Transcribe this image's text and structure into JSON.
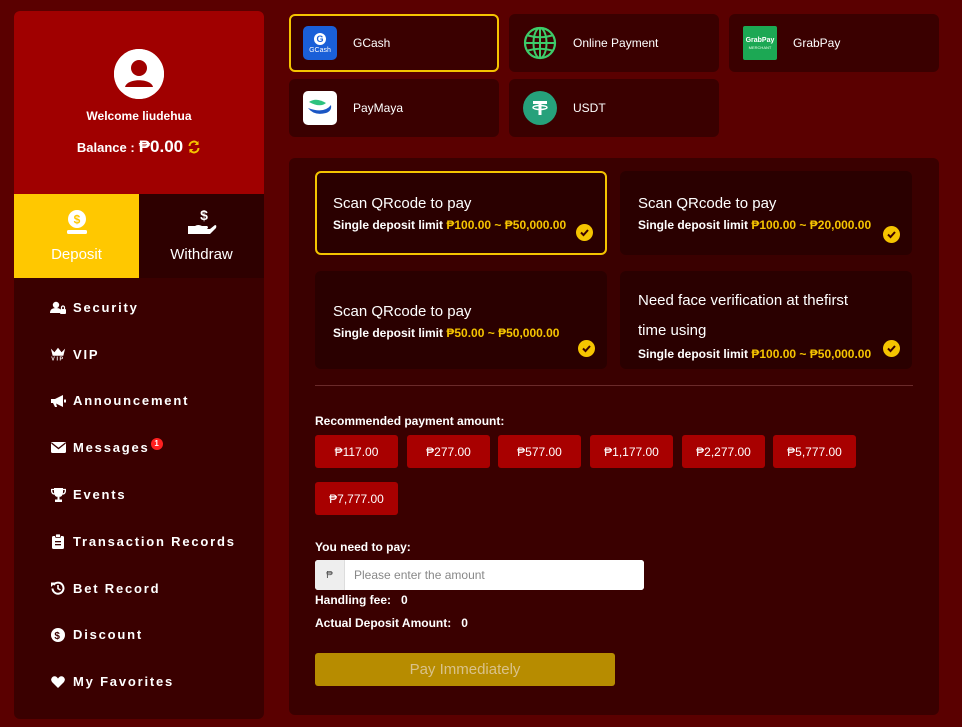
{
  "profile": {
    "welcome": "Welcome liudehua",
    "balance_label": "Balance :",
    "balance_value": "₱0.00"
  },
  "tabs": {
    "deposit": "Deposit",
    "withdraw": "Withdraw"
  },
  "menu": [
    {
      "label": "Security",
      "icon": "user-lock-icon"
    },
    {
      "label": "VIP",
      "icon": "vip-crown-icon"
    },
    {
      "label": "Announcement",
      "icon": "megaphone-icon"
    },
    {
      "label": "Messages",
      "icon": "envelope-icon",
      "badge": "1"
    },
    {
      "label": "Events",
      "icon": "trophy-icon"
    },
    {
      "label": "Transaction Records",
      "icon": "clipboard-icon"
    },
    {
      "label": "Bet Record",
      "icon": "history-icon"
    },
    {
      "label": "Discount",
      "icon": "dollar-circle-icon"
    },
    {
      "label": "My Favorites",
      "icon": "heart-icon"
    }
  ],
  "payment_methods": [
    {
      "label": "GCash",
      "icon": "gcash-logo",
      "logo_text": "GCash",
      "selected": true
    },
    {
      "label": "Online Payment",
      "icon": "globe-icon"
    },
    {
      "label": "GrabPay",
      "icon": "grabpay-logo",
      "logo_text": "GrabPay",
      "logo_sub": "MERCHANT"
    },
    {
      "label": "PayMaya",
      "icon": "paymaya-logo"
    },
    {
      "label": "USDT",
      "icon": "tether-icon"
    }
  ],
  "channels": [
    {
      "title": "Scan QRcode to pay",
      "limit_label": "Single deposit limit",
      "min": "₱100.00",
      "sep": " ~ ",
      "max": "₱50,000.00",
      "selected": true
    },
    {
      "title": "Scan QRcode to pay",
      "limit_label": "Single deposit limit",
      "min": "₱100.00",
      "sep": " ~ ",
      "max": "₱20,000.00"
    },
    {
      "title": "Scan QRcode to pay",
      "limit_label": "Single deposit limit",
      "min": "₱50.00",
      "sep": " ~ ",
      "max": "₱50,000.00"
    },
    {
      "title": "Need face verification at thefirst time using",
      "limit_label": "Single deposit limit",
      "min": "₱100.00",
      "sep": " ~ ",
      "max": "₱50,000.00"
    }
  ],
  "recommended": {
    "label": "Recommended payment amount:",
    "amounts": [
      "₱117.00",
      "₱277.00",
      "₱577.00",
      "₱1,177.00",
      "₱2,277.00",
      "₱5,777.00",
      "₱7,777.00"
    ]
  },
  "payment_form": {
    "need_to_pay_label": "You need to pay:",
    "currency_symbol": "₱",
    "amount_placeholder": "Please enter the amount",
    "handling_fee_label": "Handling fee:",
    "handling_fee_value": "0",
    "actual_deposit_label": "Actual Deposit Amount:",
    "actual_deposit_value": "0",
    "pay_button": "Pay Immediately"
  },
  "colors": {
    "background": "#5a0000",
    "sidebar": "#3a0000",
    "profile": "#a00000",
    "accent_gold": "#f5c400",
    "amount_button": "#a80000",
    "pay_button": "#b78c00"
  }
}
